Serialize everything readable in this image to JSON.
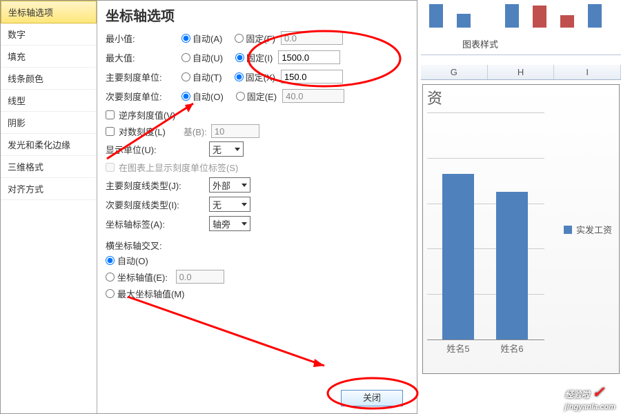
{
  "sidebar": {
    "items": [
      {
        "label": "坐标轴选项"
      },
      {
        "label": "数字"
      },
      {
        "label": "填充"
      },
      {
        "label": "线条颜色"
      },
      {
        "label": "线型"
      },
      {
        "label": "阴影"
      },
      {
        "label": "发光和柔化边缘"
      },
      {
        "label": "三维格式"
      },
      {
        "label": "对齐方式"
      }
    ]
  },
  "panel": {
    "title": "坐标轴选项",
    "rows": {
      "min": {
        "label": "最小值:",
        "auto": "自动(A)",
        "fixed": "固定(F)",
        "val": "0.0"
      },
      "max": {
        "label": "最大值:",
        "auto": "自动(U)",
        "fixed": "固定(I)",
        "val": "1500.0"
      },
      "major": {
        "label": "主要刻度单位:",
        "auto": "自动(T)",
        "fixed": "固定(X)",
        "val": "150.0"
      },
      "minor": {
        "label": "次要刻度单位:",
        "auto": "自动(O)",
        "fixed": "固定(E)",
        "val": "40.0"
      }
    },
    "reverse": "逆序刻度值(V)",
    "logscale": "对数刻度(L)",
    "logbase_label": "基(B):",
    "logbase_val": "10",
    "display_unit_label": "显示单位(U):",
    "display_unit_val": "无",
    "show_unit_label_chk": "在图表上显示刻度单位标签(S)",
    "major_tick_label": "主要刻度线类型(J):",
    "major_tick_val": "外部",
    "minor_tick_label": "次要刻度线类型(I):",
    "minor_tick_val": "无",
    "axis_label_label": "坐标轴标签(A):",
    "axis_label_val": "轴旁",
    "cross_title": "横坐标轴交叉:",
    "cross_auto": "自动(O)",
    "cross_val_label": "坐标轴值(E):",
    "cross_val": "0.0",
    "cross_max": "最大坐标轴值(M)",
    "close": "关闭"
  },
  "right": {
    "chart_style": "图表样式",
    "cols": [
      "G",
      "H",
      "I"
    ],
    "chart_title_suffix": "资",
    "legend": "实发工资",
    "xcats": [
      "姓名5",
      "姓名6"
    ]
  },
  "watermark": {
    "text": "经验啦",
    "url": "jingyanla.com"
  },
  "chart_data": {
    "type": "bar",
    "title": "...资",
    "categories": [
      "姓名5",
      "姓名6"
    ],
    "series": [
      {
        "name": "实发工资",
        "values": [
          1100,
          980
        ]
      }
    ],
    "ylim": [
      0,
      1500
    ],
    "major_unit": 150
  }
}
